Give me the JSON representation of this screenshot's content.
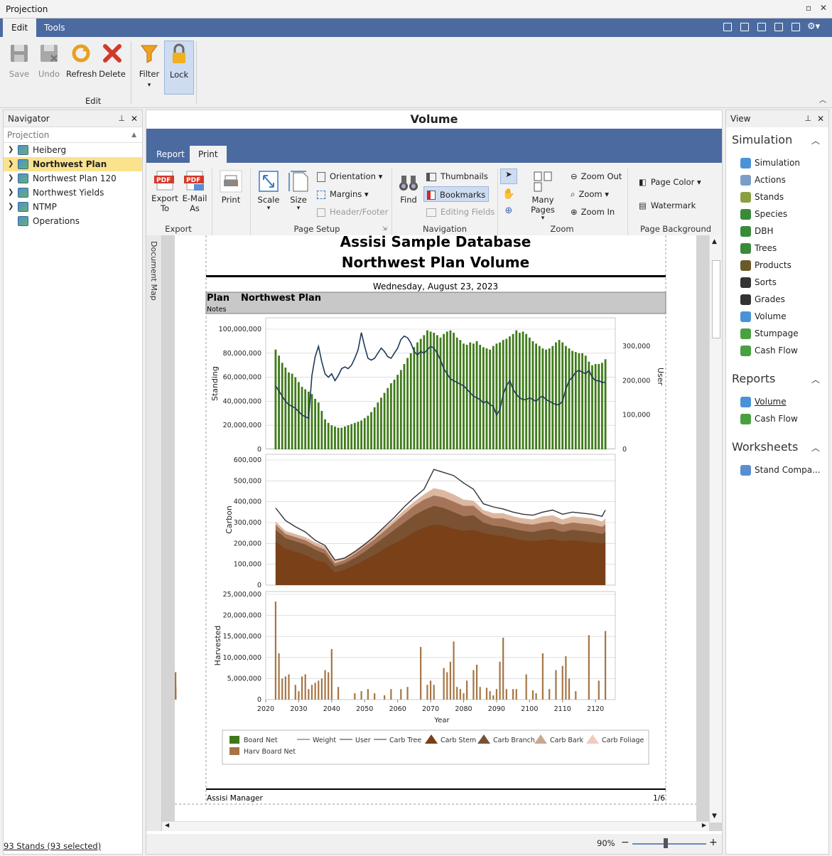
{
  "window": {
    "title": "Projection"
  },
  "menu": {
    "tabs": [
      "Edit",
      "Tools"
    ]
  },
  "ribbon": {
    "buttons": {
      "save": "Save",
      "undo": "Undo",
      "refresh": "Refresh",
      "delete": "Delete",
      "filter": "Filter",
      "lock": "Lock"
    },
    "group_label": "Edit"
  },
  "navigator": {
    "title": "Navigator",
    "header": "Projection",
    "items": [
      {
        "label": "Heiberg",
        "selected": false,
        "expandable": true
      },
      {
        "label": "Northwest Plan",
        "selected": true,
        "expandable": true
      },
      {
        "label": "Northwest Plan 120",
        "selected": false,
        "expandable": true
      },
      {
        "label": "Northwest Yields",
        "selected": false,
        "expandable": true
      },
      {
        "label": "NTMP",
        "selected": false,
        "expandable": true
      },
      {
        "label": "Operations",
        "selected": false,
        "expandable": false
      }
    ],
    "status": "93 Stands (93 selected)"
  },
  "document": {
    "title": "Volume",
    "tabs": [
      "Report",
      "Print"
    ],
    "active_tab": "Print",
    "doc_map_label": "Document Map",
    "ribbon": {
      "export": {
        "label": "Export",
        "export_to": "Export To",
        "email_as": "E-Mail As",
        "print": "Print"
      },
      "page_setup": {
        "label": "Page Setup",
        "scale": "Scale",
        "size": "Size",
        "orientation": "Orientation",
        "margins": "Margins",
        "header_footer": "Header/Footer"
      },
      "navigation": {
        "label": "Navigation",
        "find": "Find",
        "thumbnails": "Thumbnails",
        "bookmarks": "Bookmarks",
        "editing_fields": "Editing Fields"
      },
      "zoom": {
        "label": "Zoom",
        "many_pages": "Many Pages",
        "zoom_out": "Zoom Out",
        "zoom": "Zoom",
        "zoom_in": "Zoom In"
      },
      "page_background": {
        "label": "Page Background",
        "page_color": "Page Color",
        "watermark": "Watermark"
      }
    },
    "zoom_level": "90%",
    "zoom_fraction": 0.45
  },
  "report": {
    "title1": "Assisi Sample Database",
    "title2": "Northwest Plan Volume",
    "date": "Wednesday, August 23, 2023",
    "plan_label": "Plan",
    "plan_value": "Northwest Plan",
    "notes_label": "Notes",
    "footer_left": "Assisi Manager",
    "footer_right": "1/6"
  },
  "view": {
    "title": "View",
    "sections": [
      {
        "name": "Simulation",
        "items": [
          "Simulation",
          "Actions",
          "Stands",
          "Species",
          "DBH",
          "Trees",
          "Products",
          "Sorts",
          "Grades",
          "Volume",
          "Stumpage",
          "Cash Flow"
        ]
      },
      {
        "name": "Reports",
        "items": [
          "Volume",
          "Cash Flow"
        ]
      },
      {
        "name": "Worksheets",
        "items": [
          "Stand Compa..."
        ]
      }
    ]
  },
  "colors": {
    "accent": "#4a6aa0",
    "selection": "#fbe28d",
    "board_net": "#3f7a1a",
    "user_line": "#1e3a5a",
    "harv": "#a57545"
  },
  "chart_data": [
    {
      "type": "bar",
      "ylabel": "Standing",
      "y2label": "User",
      "ylim": [
        0,
        100000000
      ],
      "y2lim": [
        0,
        350000
      ],
      "yticks": [
        "0",
        "20,000,000",
        "40,000,000",
        "60,000,000",
        "80,000,000",
        "100,000,000"
      ],
      "y2ticks": [
        "0",
        "100,000",
        "200,000",
        "300,000"
      ],
      "x": [
        2023,
        2024,
        2025,
        2026,
        2027,
        2028,
        2029,
        2030,
        2031,
        2032,
        2033,
        2034,
        2035,
        2036,
        2037,
        2038,
        2039,
        2040,
        2041,
        2042,
        2043,
        2044,
        2045,
        2046,
        2047,
        2048,
        2049,
        2050,
        2051,
        2052,
        2053,
        2054,
        2055,
        2056,
        2057,
        2058,
        2059,
        2060,
        2061,
        2062,
        2063,
        2064,
        2065,
        2066,
        2067,
        2068,
        2069,
        2070,
        2071,
        2072,
        2073,
        2074,
        2075,
        2076,
        2077,
        2078,
        2079,
        2080,
        2081,
        2082,
        2083,
        2084,
        2085,
        2086,
        2087,
        2088,
        2089,
        2090,
        2091,
        2092,
        2093,
        2094,
        2095,
        2096,
        2097,
        2098,
        2099,
        2100,
        2101,
        2102,
        2103,
        2104,
        2105,
        2106,
        2107,
        2108,
        2109,
        2110,
        2111,
        2112,
        2113,
        2114,
        2115,
        2116,
        2117,
        2118,
        2119,
        2120,
        2121,
        2122,
        2123
      ],
      "series": [
        {
          "name": "Board Net",
          "kind": "bar",
          "values": [
            83000000,
            78000000,
            72000000,
            68000000,
            64000000,
            63000000,
            60000000,
            56000000,
            52000000,
            50000000,
            48000000,
            46000000,
            42000000,
            39000000,
            32000000,
            25000000,
            22000000,
            20000000,
            19000000,
            18000000,
            18000000,
            19000000,
            20000000,
            21000000,
            22000000,
            23000000,
            24000000,
            26000000,
            28000000,
            31000000,
            35000000,
            39000000,
            43000000,
            47000000,
            51000000,
            55000000,
            58000000,
            62000000,
            66000000,
            71000000,
            76000000,
            80000000,
            85000000,
            89000000,
            92000000,
            95000000,
            99000000,
            98000000,
            97000000,
            95000000,
            93000000,
            96000000,
            98000000,
            99000000,
            97000000,
            93000000,
            91000000,
            88000000,
            87000000,
            89000000,
            88000000,
            90000000,
            87000000,
            85000000,
            84000000,
            83000000,
            86000000,
            88000000,
            89000000,
            91000000,
            92000000,
            94000000,
            96000000,
            99000000,
            97000000,
            98000000,
            96000000,
            93000000,
            90000000,
            88000000,
            86000000,
            84000000,
            83000000,
            84000000,
            86000000,
            89000000,
            91000000,
            89000000,
            86000000,
            84000000,
            82000000,
            81000000,
            80000000,
            80000000,
            78000000,
            73000000,
            70000000,
            71000000,
            71000000,
            72000000,
            75000000
          ]
        },
        {
          "name": "User",
          "kind": "line",
          "axis": "y2",
          "values": [
            185000,
            170000,
            155000,
            140000,
            130000,
            125000,
            120000,
            110000,
            100000,
            95000,
            90000,
            215000,
            270000,
            300000,
            255000,
            220000,
            210000,
            220000,
            200000,
            215000,
            235000,
            240000,
            235000,
            245000,
            265000,
            290000,
            340000,
            300000,
            265000,
            260000,
            265000,
            280000,
            295000,
            285000,
            270000,
            265000,
            280000,
            295000,
            320000,
            330000,
            325000,
            310000,
            285000,
            275000,
            285000,
            280000,
            290000,
            300000,
            295000,
            280000,
            260000,
            235000,
            220000,
            205000,
            200000,
            195000,
            190000,
            185000,
            175000,
            165000,
            155000,
            150000,
            145000,
            135000,
            140000,
            130000,
            125000,
            100000,
            115000,
            160000,
            185000,
            200000,
            175000,
            160000,
            150000,
            145000,
            145000,
            150000,
            145000,
            140000,
            150000,
            155000,
            145000,
            140000,
            135000,
            130000,
            130000,
            140000,
            175000,
            200000,
            210000,
            225000,
            230000,
            225000,
            220000,
            230000,
            210000,
            200000,
            200000,
            195000,
            195000
          ]
        }
      ]
    },
    {
      "type": "area",
      "ylabel": "Carbon",
      "ylim": [
        0,
        600000
      ],
      "yticks": [
        "0",
        "100,000",
        "200,000",
        "300,000",
        "400,000",
        "500,000",
        "600,000"
      ],
      "x": [
        2023,
        2026,
        2029,
        2032,
        2035,
        2038,
        2041,
        2044,
        2047,
        2050,
        2053,
        2056,
        2059,
        2062,
        2065,
        2068,
        2071,
        2074,
        2077,
        2080,
        2083,
        2086,
        2089,
        2092,
        2095,
        2098,
        2101,
        2104,
        2107,
        2110,
        2113,
        2116,
        2119,
        2122,
        2123
      ],
      "series": [
        {
          "name": "Carb Stem",
          "values": [
            210000,
            175000,
            160000,
            145000,
            120000,
            110000,
            60000,
            75000,
            95000,
            120000,
            145000,
            175000,
            200000,
            225000,
            255000,
            275000,
            290000,
            285000,
            270000,
            260000,
            265000,
            250000,
            240000,
            235000,
            225000,
            215000,
            210000,
            215000,
            220000,
            210000,
            215000,
            210000,
            205000,
            200000,
            205000
          ]
        },
        {
          "name": "Carb Branch",
          "values": [
            265000,
            225000,
            210000,
            195000,
            170000,
            150000,
            90000,
            105000,
            130000,
            160000,
            195000,
            230000,
            265000,
            300000,
            335000,
            360000,
            380000,
            370000,
            350000,
            330000,
            335000,
            300000,
            285000,
            280000,
            270000,
            260000,
            255000,
            265000,
            270000,
            255000,
            265000,
            260000,
            255000,
            245000,
            255000
          ]
        },
        {
          "name": "Carb Bark",
          "values": [
            290000,
            245000,
            230000,
            215000,
            190000,
            170000,
            105000,
            120000,
            150000,
            185000,
            220000,
            260000,
            300000,
            340000,
            380000,
            410000,
            430000,
            420000,
            400000,
            380000,
            380000,
            340000,
            320000,
            320000,
            305000,
            295000,
            290000,
            300000,
            305000,
            290000,
            300000,
            295000,
            290000,
            280000,
            290000
          ]
        },
        {
          "name": "Carb Foliage",
          "values": [
            305000,
            260000,
            245000,
            230000,
            205000,
            185000,
            120000,
            135000,
            165000,
            200000,
            235000,
            275000,
            315000,
            360000,
            400000,
            435000,
            465000,
            455000,
            435000,
            410000,
            405000,
            360000,
            345000,
            345000,
            330000,
            320000,
            315000,
            330000,
            335000,
            315000,
            330000,
            325000,
            320000,
            305000,
            320000
          ]
        },
        {
          "name": "Carb Tree",
          "values": [
            370000,
            310000,
            280000,
            255000,
            215000,
            190000,
            120000,
            130000,
            160000,
            195000,
            235000,
            280000,
            325000,
            375000,
            420000,
            460000,
            555000,
            540000,
            525000,
            490000,
            460000,
            390000,
            375000,
            365000,
            350000,
            340000,
            335000,
            350000,
            360000,
            340000,
            350000,
            345000,
            340000,
            330000,
            360000
          ]
        }
      ]
    },
    {
      "type": "bar",
      "ylabel": "Harvested",
      "xlabel": "Year",
      "ylim": [
        0,
        25000000
      ],
      "yticks": [
        "0",
        "5,000,000",
        "10,000,000",
        "15,000,000",
        "20,000,000",
        "25,000,000"
      ],
      "xticks": [
        "2020",
        "2030",
        "2040",
        "2050",
        "2060",
        "2070",
        "2080",
        "2090",
        "2100",
        "2110",
        "2120"
      ],
      "x": [
        2023,
        2024,
        2025,
        2026,
        2027,
        2028,
        2029,
        2030,
        2031,
        2032,
        2033,
        2034,
        2035,
        2036,
        2037,
        2038,
        2039,
        2040,
        2041,
        2042,
        2043,
        2044,
        2045,
        2046,
        2047,
        2048,
        2049,
        2050,
        2051,
        2052,
        2053,
        2054,
        2055,
        2056,
        2057,
        2058,
        2059,
        2060,
        2061,
        2062,
        2063,
        2064,
        2065,
        2066,
        2067,
        2068,
        2069,
        2070,
        2071,
        2072,
        2073,
        2074,
        2075,
        2076,
        2077,
        2078,
        2079,
        2080,
        2081,
        2082,
        2083,
        2084,
        2085,
        2086,
        2087,
        2088,
        2089,
        2090,
        2091,
        2092,
        2093,
        2094,
        2095,
        2096,
        2097,
        2098,
        2099,
        2100,
        2101,
        2102,
        2103,
        2104,
        2105,
        2106,
        2107,
        2108,
        2109,
        2110,
        2111,
        2112,
        2113,
        2114,
        2115,
        2116,
        2117,
        2118,
        2119,
        2120,
        2121,
        2122,
        2123
      ],
      "series": [
        {
          "name": "Harv Board Net",
          "values": [
            23300000,
            11000000,
            5000000,
            5500000,
            6000000,
            0,
            3500000,
            2000000,
            5500000,
            6000000,
            2500000,
            3500000,
            4000000,
            4500000,
            5000000,
            7000000,
            6500000,
            12000000,
            0,
            3000000,
            0,
            0,
            0,
            0,
            1500000,
            0,
            2000000,
            0,
            2500000,
            0,
            1500000,
            0,
            0,
            1000000,
            0,
            2500000,
            0,
            0,
            2500000,
            0,
            3000000,
            0,
            0,
            0,
            12500000,
            0,
            3500000,
            4500000,
            3500000,
            0,
            0,
            7500000,
            6500000,
            9000000,
            13800000,
            3000000,
            2500000,
            1500000,
            4500000,
            0,
            7000000,
            8300000,
            3000000,
            0,
            2800000,
            2000000,
            1000000,
            2500000,
            9000000,
            14700000,
            2500000,
            0,
            2500000,
            2500000,
            0,
            0,
            6000000,
            0,
            2200000,
            1500000,
            0,
            11000000,
            0,
            2500000,
            0,
            7000000,
            0,
            8000000,
            10300000,
            5000000,
            0,
            2000000,
            0,
            0,
            0,
            15300000,
            0,
            0,
            4500000,
            0,
            16300000,
            2500000,
            0,
            6500000,
            0,
            3000000,
            0,
            1500000,
            0,
            3000000,
            0
          ]
        }
      ]
    }
  ],
  "legend": [
    "Board Net",
    "Weight",
    "User",
    "Carb Tree",
    "Carb Stem",
    "Carb Branch",
    "Carb Bark",
    "Carb Foliage",
    "Harv Board Net"
  ]
}
